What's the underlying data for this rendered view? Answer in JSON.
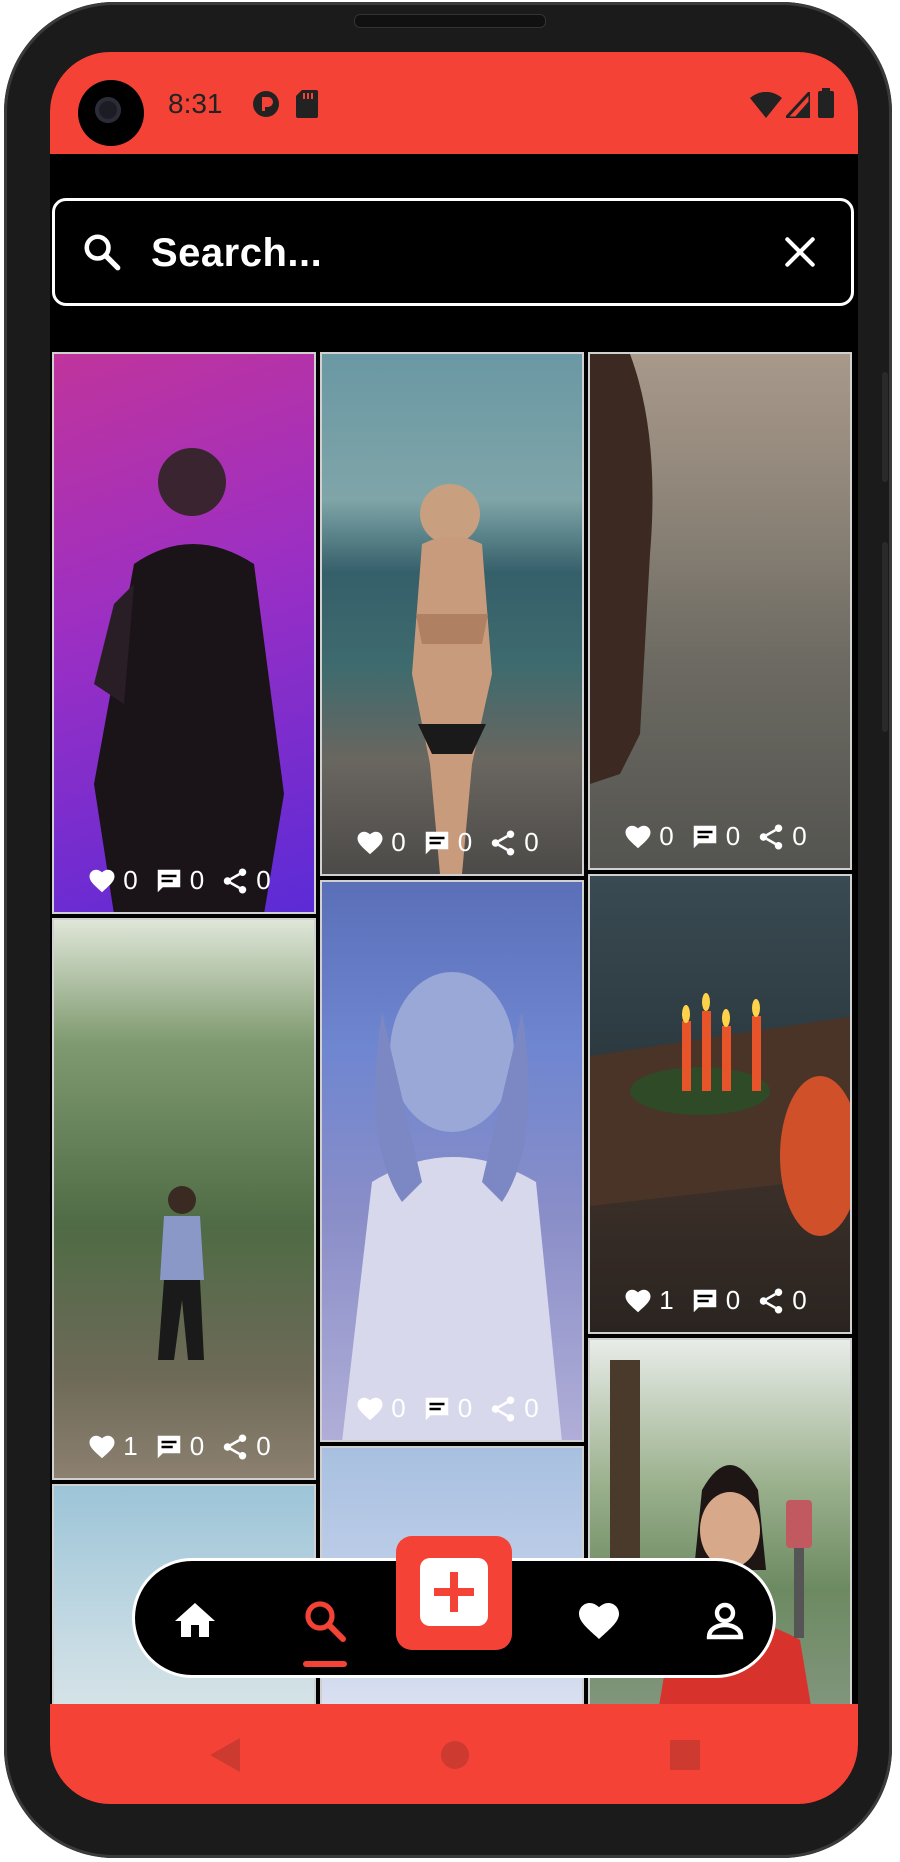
{
  "status_bar": {
    "time": "8:31",
    "bg_color": "#f44336"
  },
  "search": {
    "placeholder": "Search..."
  },
  "posts": [
    {
      "likes": "0",
      "comments": "0",
      "shares": "0",
      "thumb": "purple-portrait"
    },
    {
      "likes": "0",
      "comments": "0",
      "shares": "0",
      "thumb": "beach-bikini"
    },
    {
      "likes": "0",
      "comments": "0",
      "shares": "0",
      "thumb": "ocean-shore"
    },
    {
      "likes": "1",
      "comments": "0",
      "shares": "0",
      "thumb": "forest-walk"
    },
    {
      "likes": "0",
      "comments": "0",
      "shares": "0",
      "thumb": "blue-sparkle-portrait"
    },
    {
      "likes": "1",
      "comments": "0",
      "shares": "0",
      "thumb": "candles-table"
    },
    {
      "thumb": "woman-phone-gimbal"
    },
    {
      "thumb": "sky-partial"
    },
    {
      "thumb": "light-partial"
    }
  ],
  "nav": {
    "items": [
      "home-icon",
      "search-icon",
      "add-icon",
      "heart-icon",
      "profile-icon"
    ],
    "active": "search-icon",
    "accent": "#f44336"
  }
}
